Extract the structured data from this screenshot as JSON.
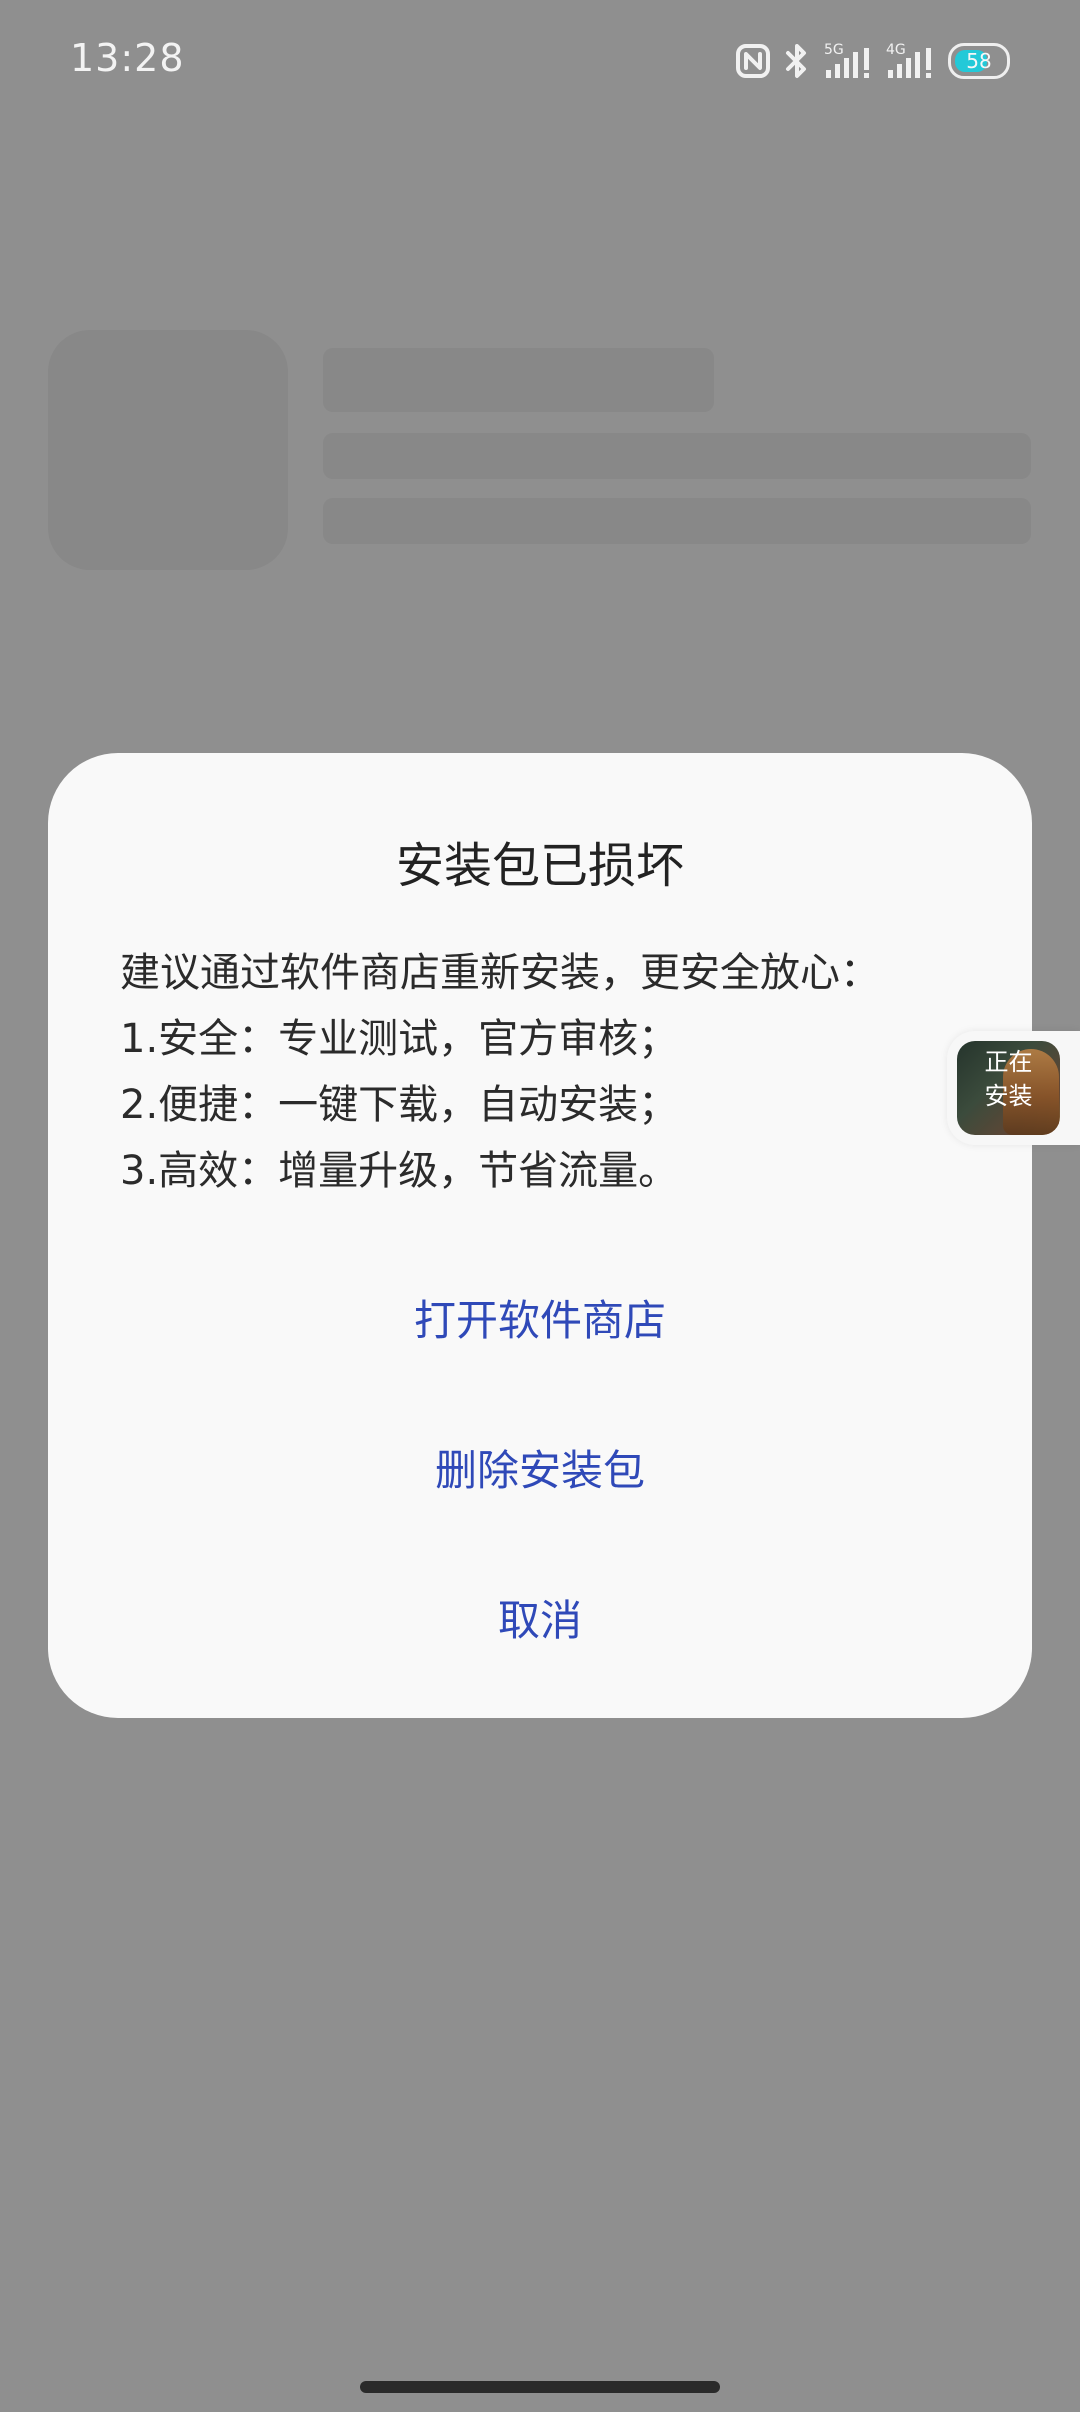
{
  "status_bar": {
    "time": "13:28",
    "battery": "58",
    "signal_labels": [
      "5G",
      "4G"
    ],
    "icons": [
      "nfc-icon",
      "bluetooth-icon",
      "signal-5g-icon",
      "signal-4g-icon",
      "battery-icon"
    ]
  },
  "dialog": {
    "title": "安装包已损坏",
    "body_lines": [
      "建议通过软件商店重新安装，更安全放心：",
      "1.安全：专业测试，官方审核；",
      "2.便捷：一键下载，自动安装；",
      "3.高效：增量升级，节省流量。"
    ],
    "actions": {
      "open_store": "打开软件商店",
      "delete_package": "删除安装包",
      "cancel": "取消"
    }
  },
  "installing_widget": {
    "label_line1": "正在",
    "label_line2": "安装"
  },
  "colors": {
    "accent": "#2f49b8",
    "dim_background": "#8f8f8f",
    "dialog_background": "#f9f9f9",
    "battery_level": "#23c9d8"
  }
}
